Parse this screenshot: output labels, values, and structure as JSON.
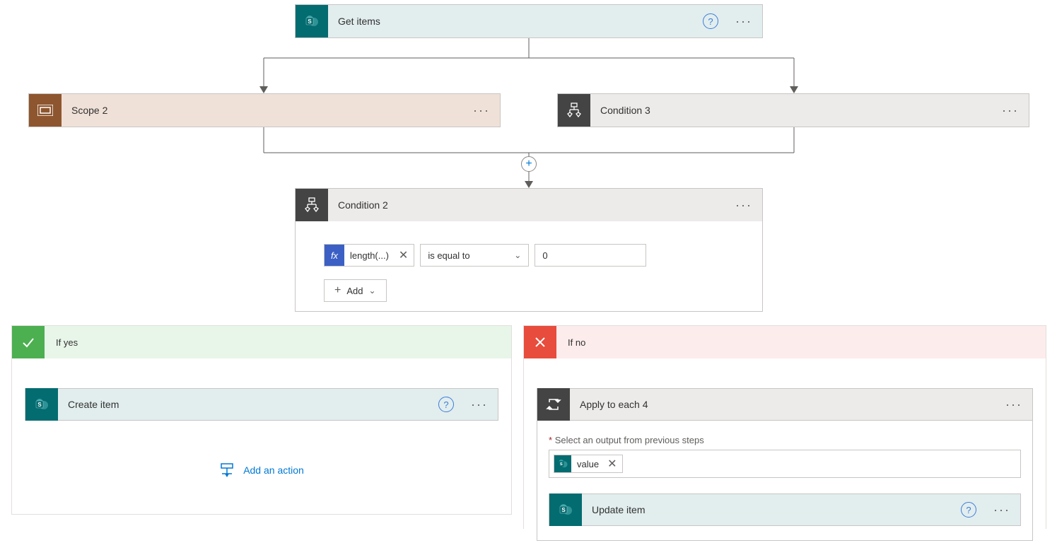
{
  "getItems": {
    "title": "Get items"
  },
  "scope2": {
    "title": "Scope 2"
  },
  "condition3": {
    "title": "Condition 3"
  },
  "condition2": {
    "title": "Condition 2",
    "expression": "length(...)",
    "operator": "is equal to",
    "value": "0",
    "addLabel": "Add"
  },
  "ifYes": {
    "label": "If yes",
    "createItem": "Create item",
    "addAction": "Add an action"
  },
  "ifNo": {
    "label": "If no",
    "applyToEach": "Apply to each 4",
    "selectLabel": "Select an output from previous steps",
    "tokenValue": "value",
    "updateItem": "Update item"
  }
}
